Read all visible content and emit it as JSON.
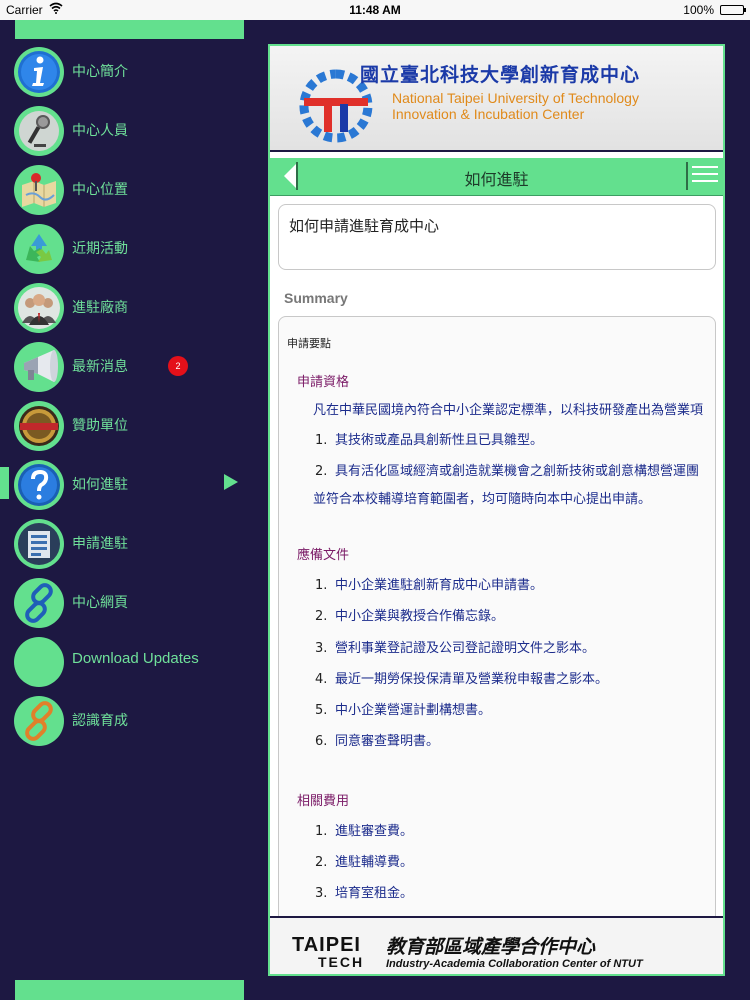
{
  "status_bar": {
    "carrier": "Carrier",
    "time": "11:48 AM",
    "battery_percent": "100%",
    "battery_level": 1.0
  },
  "sidebar": {
    "items": [
      {
        "label": "中心簡介",
        "icon": "info-icon"
      },
      {
        "label": "中心人員",
        "icon": "microphone-icon"
      },
      {
        "label": "中心位置",
        "icon": "map-pin-icon"
      },
      {
        "label": "近期活動",
        "icon": "recycle-icon"
      },
      {
        "label": "進駐廠商",
        "icon": "people-icon"
      },
      {
        "label": "最新消息",
        "icon": "megaphone-icon",
        "badge": "2"
      },
      {
        "label": "贊助單位",
        "icon": "seal-icon"
      },
      {
        "label": "如何進駐",
        "icon": "question-icon",
        "selected": true
      },
      {
        "label": "申請進駐",
        "icon": "form-icon"
      },
      {
        "label": "中心網頁",
        "icon": "chain-blue-icon"
      },
      {
        "label": "Download Updates",
        "icon": "blank-icon"
      },
      {
        "label": "認識育成",
        "icon": "chain-orange-icon"
      }
    ]
  },
  "banner": {
    "title_zh": "國立臺北科技大學創新育成中心",
    "title_en_line1": "National Taipei University of Technology",
    "title_en_line2": "Innovation & Incubation Center"
  },
  "navbar": {
    "title": "如何進駐"
  },
  "search_box": {
    "value": "如何申請進駐育成中心"
  },
  "summary": {
    "label": "Summary",
    "heading": "申請要點",
    "sections": [
      {
        "title": "申請資格",
        "intro": "凡在中華民國境內符合中小企業認定標準，以科技研發產出為營業項",
        "items": [
          "其技術或產品具創新性且已具雛型。",
          "具有活化區域經濟或創造就業機會之創新技術或創意構想營運團"
        ],
        "outro": "並符合本校輔導培育範圍者，均可隨時向本中心提出申請。"
      },
      {
        "title": "應備文件",
        "items": [
          "中小企業進駐創新育成中心申請書。",
          "中小企業與教授合作備忘錄。",
          "營利事業登記證及公司登記證明文件之影本。",
          "最近一期勞保投保清單及營業稅申報書之影本。",
          "中小企業營運計劃構想書。",
          "同意審查聲明書。"
        ]
      },
      {
        "title": "相關費用",
        "items": [
          "進駐審查費。",
          "進駐輔導費。",
          "培育室租金。"
        ]
      }
    ]
  },
  "footer": {
    "logo_line1": "TAIPEI",
    "logo_line2": "TECH",
    "title_zh": "教育部區域產學合作中心",
    "title_en": "Industry-Academia Collaboration Center of NTUT"
  },
  "colors": {
    "accent": "#63e08e",
    "background": "#1d1842",
    "badge": "#e4101a",
    "link": "#1c2c8c",
    "section": "#7a1a66"
  }
}
